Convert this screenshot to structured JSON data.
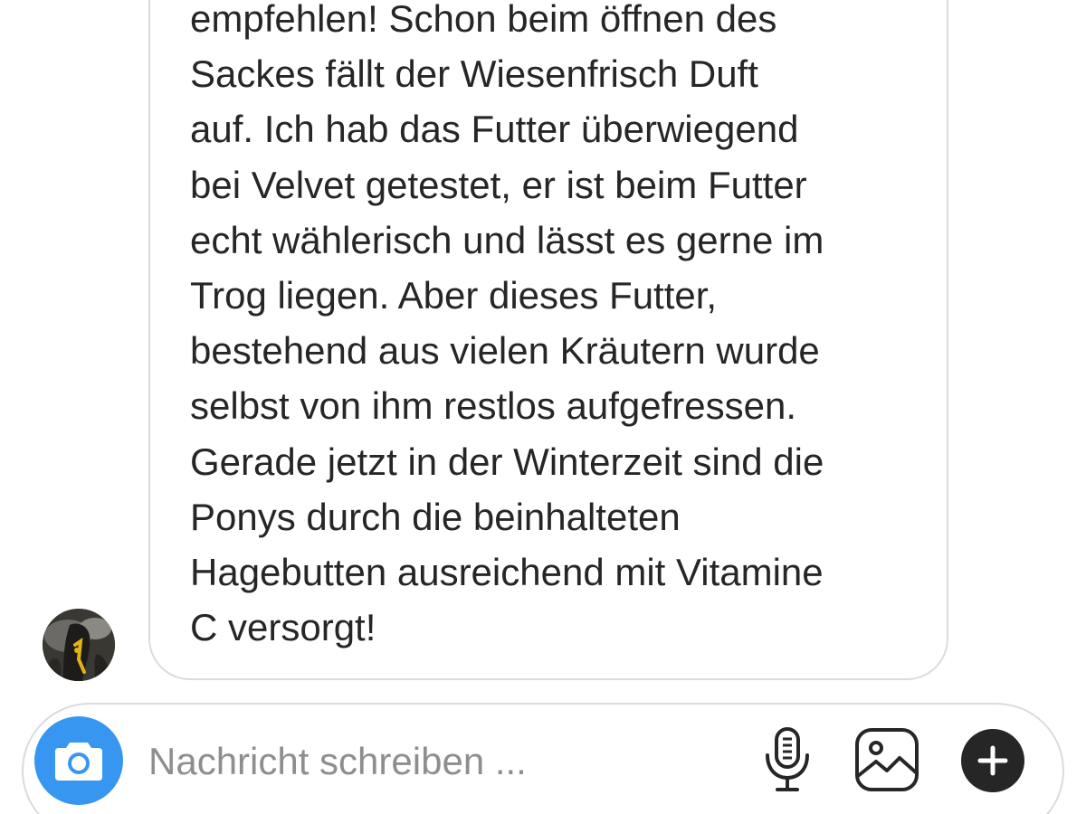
{
  "colors": {
    "text": "#262626",
    "placeholder": "#8e8e8e",
    "border": "#dbdbdb",
    "camera_button": "#3797f0",
    "plus_button": "#262626"
  },
  "message": {
    "lines": [
      "empfehlen! Schon beim öffnen des",
      "Sackes fällt der Wiesenfrisch Duft",
      "auf. Ich hab das Futter überwiegend",
      "bei Velvet getestet, er ist beim Futter",
      "echt wählerisch und lässt es gerne im",
      "Trog liegen. Aber dieses Futter,",
      "bestehend aus vielen Kräutern wurde",
      "selbst von ihm restlos aufgefressen.",
      "Gerade jetzt in der Winterzeit sind die",
      "Ponys durch die beinhalteten",
      "Hagebutten ausreichend mit Vitamine",
      "C versorgt!"
    ]
  },
  "composer": {
    "placeholder": "Nachricht schreiben ...",
    "value": "",
    "icons": {
      "camera": "camera-icon",
      "microphone": "microphone-icon",
      "gallery": "gallery-icon",
      "plus": "plus-icon"
    }
  }
}
